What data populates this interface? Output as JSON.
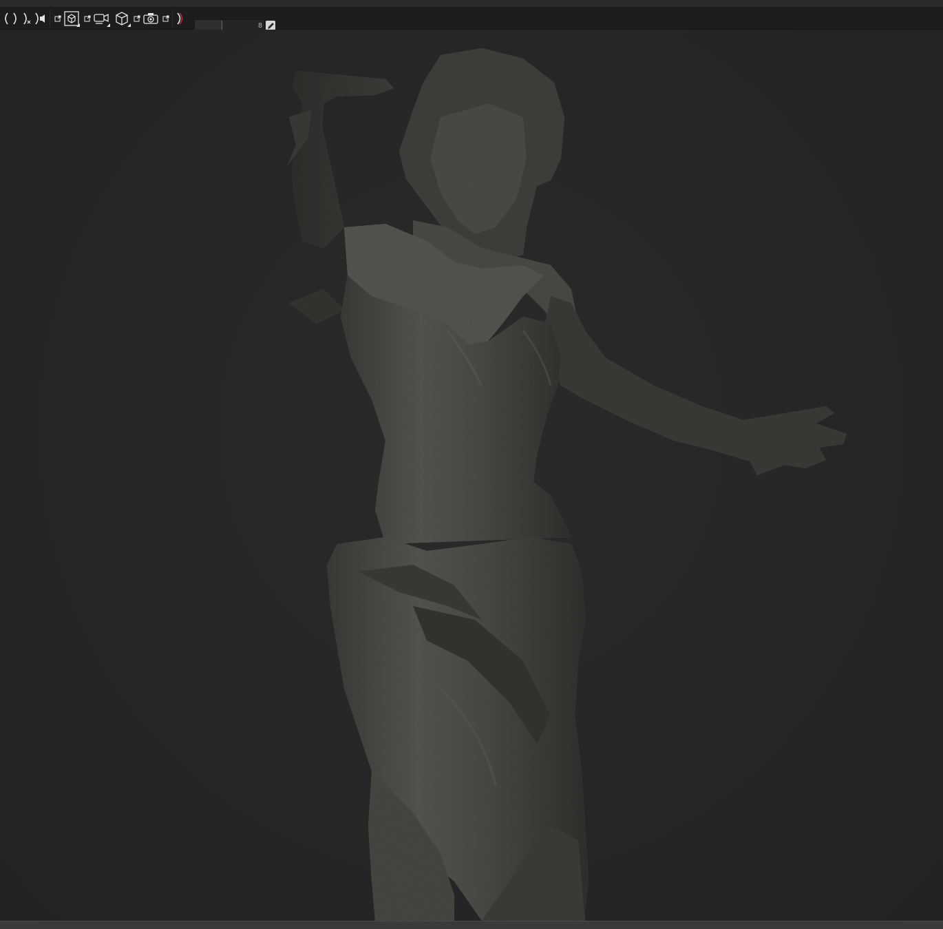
{
  "toolbar": {
    "buttons": [
      {
        "icon": "bracket-open-icon"
      },
      {
        "icon": "bracket-close-icon"
      },
      {
        "icon": "bracket-close-clear-icon"
      },
      {
        "icon": "bracket-speaker-icon"
      },
      {
        "icon": "popout-icon"
      },
      {
        "icon": "box-select-icon"
      },
      {
        "icon": "popout-icon"
      },
      {
        "icon": "camera-screen-icon"
      },
      {
        "icon": "cube-icon"
      },
      {
        "icon": "popout-icon"
      },
      {
        "icon": "photo-camera-icon"
      },
      {
        "icon": "popout-icon"
      },
      {
        "icon": "bracket-record-icon"
      }
    ],
    "slider": {
      "value": "8",
      "fill_fraction": 0.39
    },
    "edit_icon": "pencil-icon"
  },
  "viewport": {
    "content": "3d-statue-model",
    "accent_color": "#c8283a"
  },
  "colors": {
    "background": "#262626",
    "toolbar": "#1d1d1d",
    "icon": "#e6e6e6"
  }
}
